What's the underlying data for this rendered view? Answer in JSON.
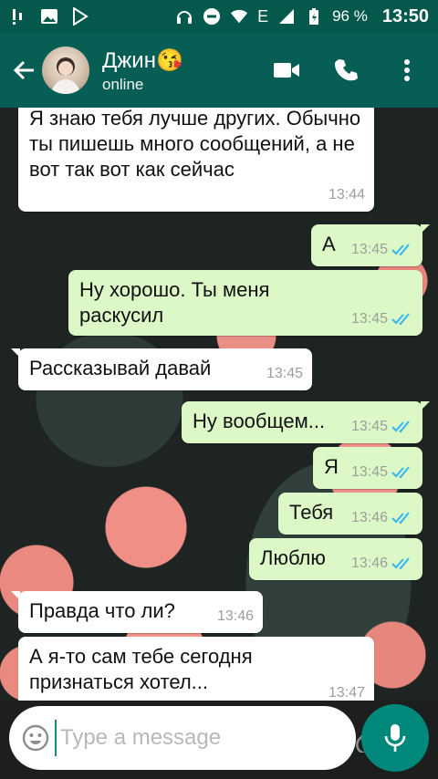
{
  "status_bar": {
    "battery": "96 %",
    "time": "13:50",
    "network": "E"
  },
  "header": {
    "name": "Джин😘",
    "status": "online"
  },
  "messages": [
    {
      "dir": "in",
      "text": "Я знаю тебя лучше других. Обычно ты пишешь много сообщений, а не вот так вот как сейчас",
      "time": "13:44"
    },
    {
      "dir": "out",
      "text": "А",
      "time": "13:45"
    },
    {
      "dir": "out",
      "text": "Ну хорошо. Ты меня раскусил",
      "time": "13:45"
    },
    {
      "dir": "in",
      "text": "Рассказывай давай",
      "time": "13:45"
    },
    {
      "dir": "out",
      "text": "Ну вообщем...",
      "time": "13:45"
    },
    {
      "dir": "out",
      "text": "Я",
      "time": "13:45"
    },
    {
      "dir": "out",
      "text": "Тебя",
      "time": "13:46"
    },
    {
      "dir": "out",
      "text": "Люблю",
      "time": "13:46"
    },
    {
      "dir": "in",
      "text": "Правда что ли?",
      "time": "13:46"
    },
    {
      "dir": "in",
      "text": "А я-то сам тебе сегодня признаться хотел...",
      "time": "13:47"
    }
  ],
  "composer": {
    "placeholder": "Type a message"
  },
  "colors": {
    "header": "#075e54",
    "statusbar": "#04584c",
    "outgoing_bubble": "#dcf8c6",
    "incoming_bubble": "#ffffff",
    "read_check": "#34b7f1",
    "mic_button": "#00897b"
  },
  "icons": [
    "back-arrow-icon",
    "video-call-icon",
    "phone-icon",
    "more-vert-icon",
    "emoji-icon",
    "attach-icon",
    "camera-icon",
    "mic-icon"
  ]
}
